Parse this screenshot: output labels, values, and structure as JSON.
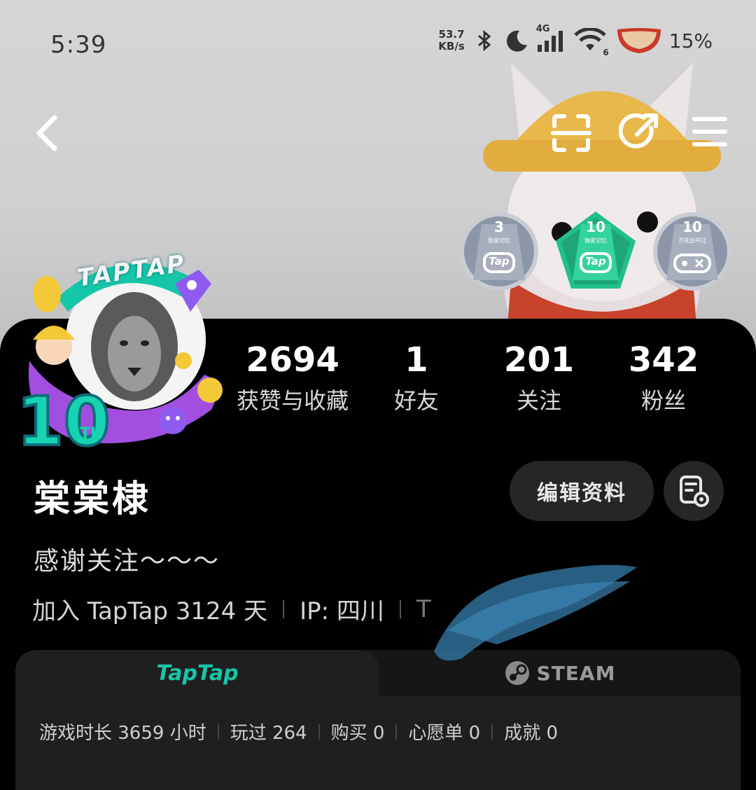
{
  "status_bar": {
    "time": "5:39",
    "net_speed_value": "53.7",
    "net_speed_unit": "KB/s",
    "signal": "4G",
    "wifi_level": "6",
    "battery": "15%"
  },
  "badges": [
    {
      "number": "3",
      "caption": "独家记忆",
      "label": "Tap",
      "color": "#8c96a8"
    },
    {
      "number": "10",
      "caption": "独家记忆",
      "label": "Tap",
      "color": "#21c08b"
    },
    {
      "number": "10",
      "caption": "万花丛中过",
      "label": "",
      "color": "#8c96a8"
    }
  ],
  "avatar": {
    "frame_text": "TAPTAP",
    "anniversary": "10",
    "anniversary_suffix": "TH"
  },
  "stats": [
    {
      "value": "2694",
      "label": "获赞与收藏"
    },
    {
      "value": "1",
      "label": "好友"
    },
    {
      "value": "201",
      "label": "关注"
    },
    {
      "value": "342",
      "label": "粉丝"
    }
  ],
  "profile": {
    "username": "棠棠棣",
    "edit_label": "编辑资料",
    "bio": "感谢关注～～～",
    "join_text": "加入 TapTap 3124 天",
    "ip_text": "IP: 四川",
    "extra_text": "T"
  },
  "platform_tabs": {
    "taptap": "TapTap",
    "steam": "STEAM"
  },
  "game_stats": [
    "游戏时长 3659 小时",
    "玩过 264",
    "购买 0",
    "心愿单 0",
    "成就 0"
  ],
  "colors": {
    "accent": "#16c6a8",
    "card_bg": "#000000",
    "button_bg": "#262626"
  }
}
